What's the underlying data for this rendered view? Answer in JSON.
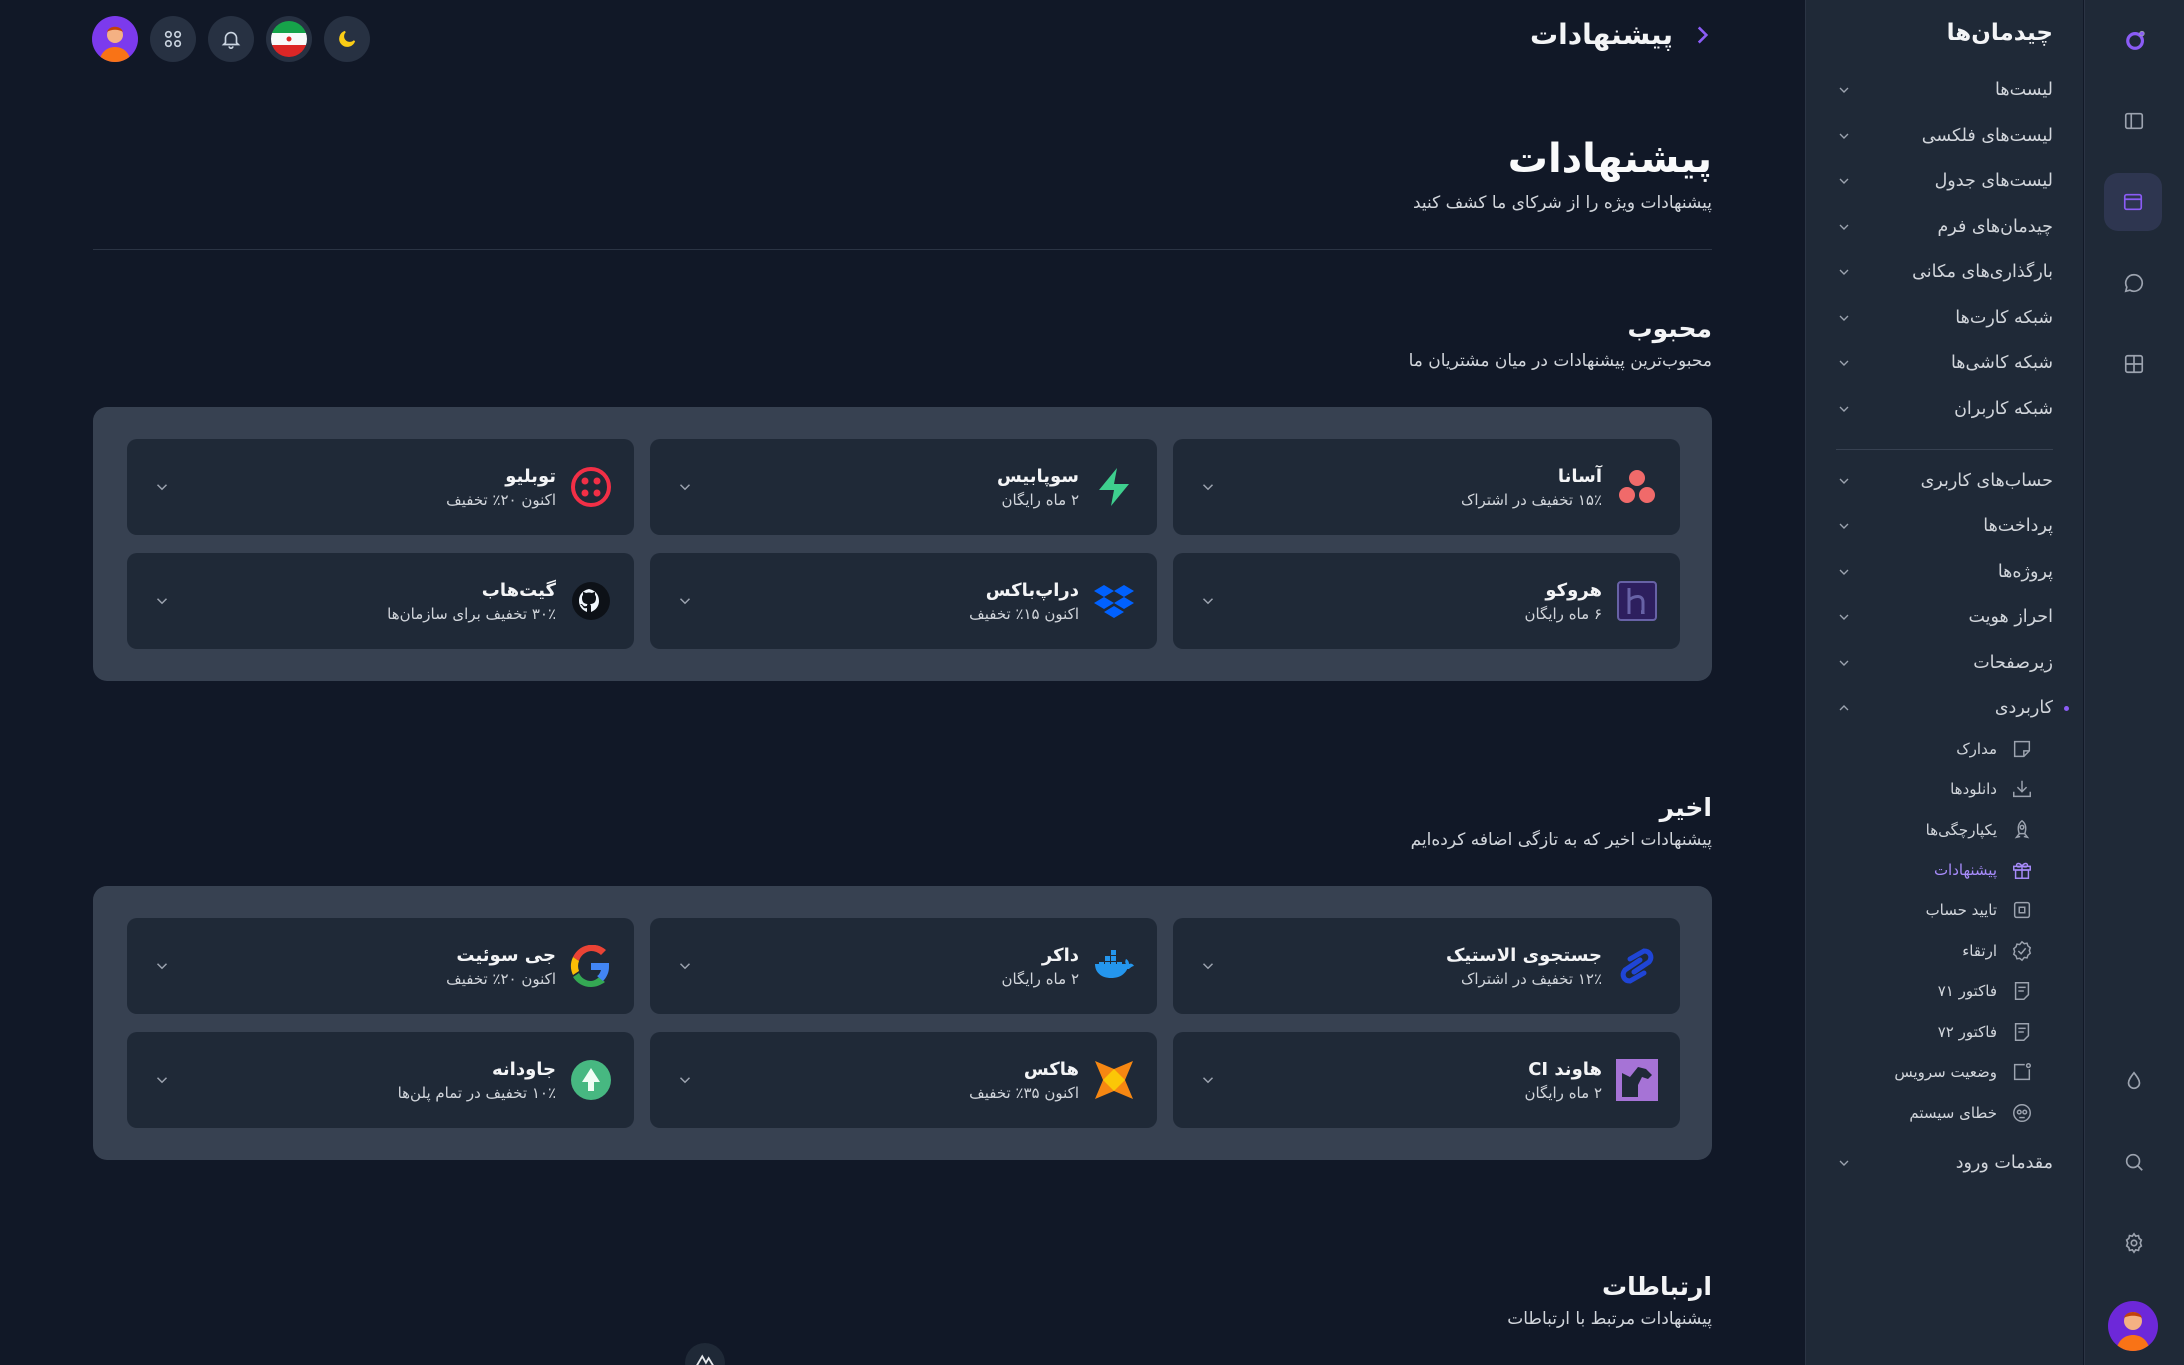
{
  "colors": {
    "accent": "#8b5cf6",
    "background": "#111827",
    "surface": "#1f2937",
    "panel": "#374151"
  },
  "rail": {
    "icons": [
      "logo-icon",
      "sidebar-toggle-icon",
      "layouts-icon",
      "chat-icon",
      "grid-icon",
      "drop-icon",
      "search-icon",
      "gear-icon"
    ]
  },
  "sidebar": {
    "title": "چیدمان‌ها",
    "items": [
      {
        "label": "لیست‌ها"
      },
      {
        "label": "لیست‌های فلکسی"
      },
      {
        "label": "لیست‌های جدول"
      },
      {
        "label": "چیدمان‌های فرم"
      },
      {
        "label": "بارگذاری‌های مکانی"
      },
      {
        "label": "شبکه کارت‌ها"
      },
      {
        "label": "شبکه کاشی‌ها"
      },
      {
        "label": "شبکه کاربران"
      }
    ],
    "items2": [
      {
        "label": "حساب‌های کاربری"
      },
      {
        "label": "پرداخت‌ها"
      },
      {
        "label": "پروژه‌ها"
      },
      {
        "label": "احراز هویت"
      },
      {
        "label": "زیرصفحات"
      },
      {
        "label": "کاربردی"
      }
    ],
    "sub_items": [
      {
        "label": "مدارک",
        "icon": "sticky-note-icon"
      },
      {
        "label": "دانلودها",
        "icon": "download-icon"
      },
      {
        "label": "یکپارچگی‌ها",
        "icon": "rocket-icon"
      },
      {
        "label": "پیشنهادات",
        "icon": "gift-icon"
      },
      {
        "label": "تایید حساب",
        "icon": "verify-icon"
      },
      {
        "label": "ارتقاء",
        "icon": "badge-check-icon"
      },
      {
        "label": "فاکتور ۷۱",
        "icon": "invoice-icon"
      },
      {
        "label": "فاکتور ۷۲",
        "icon": "invoice-icon"
      },
      {
        "label": "وضعیت سرویس",
        "icon": "status-icon"
      },
      {
        "label": "خطای سیستم",
        "icon": "error-icon"
      }
    ],
    "last_item": {
      "label": "مقدمات ورود"
    }
  },
  "header": {
    "breadcrumb": "پیشنهادات"
  },
  "page": {
    "title": "پیشنهادات",
    "subtitle": "پیشنهادات ویژه را از شرکای ما کشف کنید"
  },
  "sections": [
    {
      "title": "محبوب",
      "subtitle": "محبوب‌ترین پیشنهادات در میان مشتریان ما",
      "cards": [
        {
          "name": "آسانا",
          "desc": "۱۵٪ تخفیف در اشتراک",
          "icon": "asana-icon"
        },
        {
          "name": "سوپابیس",
          "desc": "۲ ماه رایگان",
          "icon": "supabase-icon"
        },
        {
          "name": "توبلیو",
          "desc": "اکنون ۲۰٪ تخفیف",
          "icon": "twilio-icon"
        },
        {
          "name": "هروکو",
          "desc": "۶ ماه رایگان",
          "icon": "heroku-icon"
        },
        {
          "name": "دراپ‌باکس",
          "desc": "اکنون ۱۵٪ تخفیف",
          "icon": "dropbox-icon"
        },
        {
          "name": "گیت‌هاب",
          "desc": "۳۰٪ تخفیف برای سازمان‌ها",
          "icon": "github-icon"
        }
      ]
    },
    {
      "title": "اخیر",
      "subtitle": "پیشنهادات اخیر که به تازگی اضافه کرده‌ایم",
      "cards": [
        {
          "name": "جستجوی الاستیک",
          "desc": "۱۲٪ تخفیف در اشتراک",
          "icon": "elastic-icon"
        },
        {
          "name": "داکر",
          "desc": "۲ ماه رایگان",
          "icon": "docker-icon"
        },
        {
          "name": "جی سوئیت",
          "desc": "اکنون ۲۰٪ تخفیف",
          "icon": "google-icon"
        },
        {
          "name": "هاوند CI",
          "desc": "۲ ماه رایگان",
          "icon": "hound-icon"
        },
        {
          "name": "هاکس",
          "desc": "اکنون ۳۵٪ تخفیف",
          "icon": "haxe-icon"
        },
        {
          "name": "جاودانه",
          "desc": "۱۰٪ تخفیف در تمام پلن‌ها",
          "icon": "evergreen-icon"
        }
      ]
    },
    {
      "title": "ارتباطات",
      "subtitle": "پیشنهادات مرتبط با ارتباطات"
    }
  ]
}
